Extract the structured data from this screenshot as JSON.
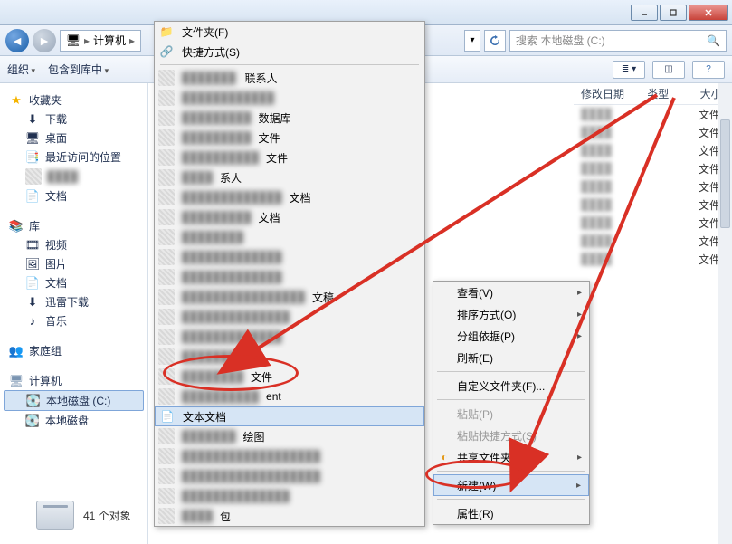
{
  "window": {
    "min_tip": "最小化",
    "max_tip": "最大化",
    "close_tip": "关闭"
  },
  "breadcrumb": {
    "root_icon": "computer-icon",
    "seg1": "计算机",
    "seg2": "›"
  },
  "search": {
    "placeholder": "搜索 本地磁盘 (C:)"
  },
  "toolbar": {
    "organize": "组织",
    "include": "包含到库中",
    "views_tip": "视图"
  },
  "sidebar": {
    "favorites": {
      "label": "收藏夹",
      "items": [
        "下载",
        "桌面",
        "最近访问的位置"
      ],
      "extra": "文档"
    },
    "libraries": {
      "label": "库",
      "items": [
        "视频",
        "图片",
        "文档",
        "迅雷下载",
        "音乐"
      ]
    },
    "homegroup": {
      "label": "家庭组"
    },
    "computer": {
      "label": "计算机",
      "drives": [
        "本地磁盘 (C:)",
        "本地磁盘"
      ]
    }
  },
  "columns": {
    "date": "修改日期",
    "type": "类型",
    "size": "大小"
  },
  "rows": {
    "type_folder": "文件夹",
    "count": 9
  },
  "submenu": {
    "folder": "文件夹(F)",
    "shortcut": "快捷方式(S)",
    "suffix_contact_file": "联系人",
    "suffix_db": "数据库",
    "suffix_file": "文件",
    "suffix_doc": "文档",
    "suffix_person": "系人",
    "suffix_draft": "文稿",
    "file_label": "文件",
    "ent_suffix": "ent",
    "textdoc": "文本文档",
    "paint": "绘图",
    "pack": "包"
  },
  "context": {
    "view": "查看(V)",
    "sort": "排序方式(O)",
    "group": "分组依据(P)",
    "refresh": "刷新(E)",
    "customize": "自定义文件夹(F)...",
    "paste": "粘贴(P)",
    "paste_shortcut": "粘贴快捷方式(S)",
    "share_sync": "共享文件夹同步",
    "new": "新建(W)",
    "properties": "属性(R)"
  },
  "status": {
    "count_label": "41 个对象"
  },
  "annotation": {
    "target1": "文本文档",
    "target2": "新建(W)"
  }
}
